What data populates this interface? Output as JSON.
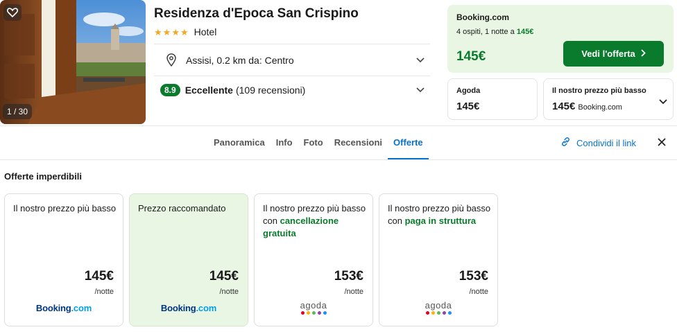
{
  "hero": {
    "counter": "1 / 30",
    "favorite_icon": "heart-icon"
  },
  "hotel": {
    "name": "Residenza d'Epoca San Crispino",
    "stars": 4,
    "type": "Hotel",
    "location": "Assisi, 0.2 km da: Centro",
    "score": "8.9",
    "score_word": "Eccellente",
    "score_count": "(109 recensioni)"
  },
  "main_deal": {
    "site": "Booking.com",
    "subtitle_prefix": "4 ospiti, 1 notte a",
    "subtitle_price": "145€",
    "price": "145€",
    "cta": "Vedi l'offerta"
  },
  "mini_deals": [
    {
      "title": "Agoda",
      "price": "145€",
      "site": ""
    },
    {
      "title": "Il nostro prezzo più basso",
      "price": "145€",
      "site": "Booking.com"
    }
  ],
  "tabs": [
    {
      "label": "Panoramica",
      "active": false
    },
    {
      "label": "Info",
      "active": false
    },
    {
      "label": "Foto",
      "active": false
    },
    {
      "label": "Recensioni",
      "active": false
    },
    {
      "label": "Offerte",
      "active": true
    }
  ],
  "share_label": "Condividi il link",
  "section_title": "Offerte imperdibili",
  "offers": [
    {
      "desc": "Il nostro prezzo più basso",
      "highlight": "",
      "price": "145€",
      "unit": "/notte",
      "provider": "Booking.com"
    },
    {
      "desc": "Prezzo raccomandato",
      "highlight": "",
      "price": "145€",
      "unit": "/notte",
      "provider": "Booking.com"
    },
    {
      "desc": "Il nostro prezzo più basso con",
      "highlight": "cancellazione gratuita",
      "price": "153€",
      "unit": "/notte",
      "provider": "agoda"
    },
    {
      "desc": "Il nostro prezzo più basso con",
      "highlight": "paga in struttura",
      "price": "153€",
      "unit": "/notte",
      "provider": "agoda"
    }
  ],
  "colors": {
    "green": "#0a7a2c",
    "blue": "#0872ca",
    "mint": "#e9f6e4",
    "star": "#f5a623"
  }
}
